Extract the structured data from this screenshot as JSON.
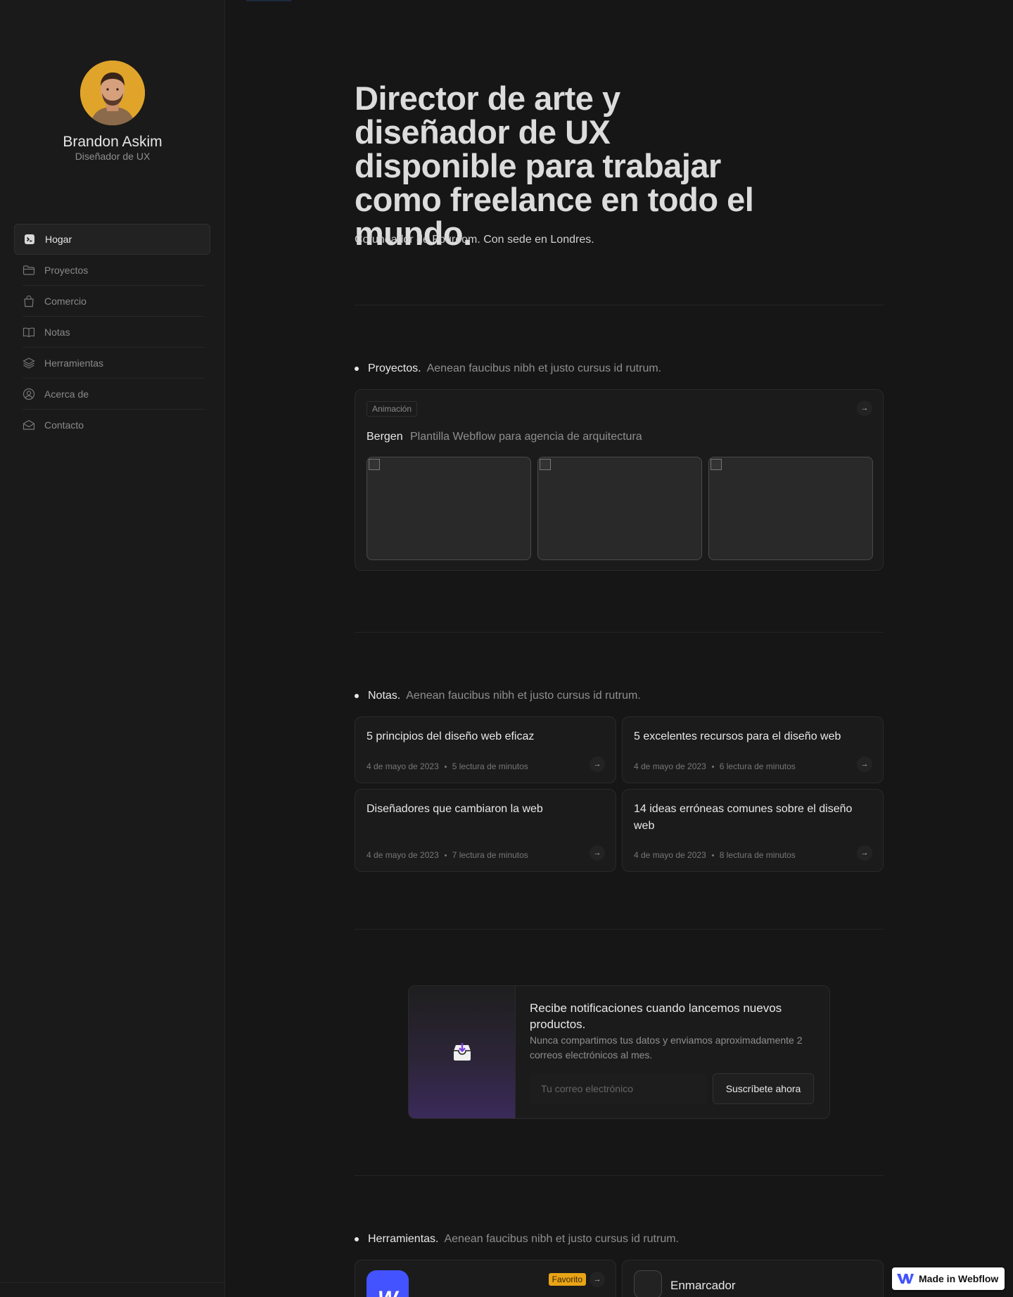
{
  "profile": {
    "name": "Brandon Askim",
    "role": "Diseñador de UX"
  },
  "nav": [
    {
      "label": "Hogar",
      "icon": "terminal-icon",
      "active": true
    },
    {
      "label": "Proyectos",
      "icon": "folder-icon"
    },
    {
      "label": "Comercio",
      "icon": "shopping-bag-icon"
    },
    {
      "label": "Notas",
      "icon": "book-icon"
    },
    {
      "label": "Herramientas",
      "icon": "layers-icon"
    },
    {
      "label": "Acerca de",
      "icon": "user-circle-icon"
    },
    {
      "label": "Contacto",
      "icon": "envelope-icon"
    }
  ],
  "hero": {
    "title": "Director de arte y diseñador de UX disponible para trabajar como freelance en todo el mundo.",
    "subtitle": "Cofundador de Fouroom. Con sede en Londres."
  },
  "projects": {
    "title": "Proyectos.",
    "desc": "Aenean faucibus nibh et justo cursus id rutrum.",
    "card": {
      "tag": "Animación",
      "title": "Bergen",
      "desc": "Plantilla Webflow para agencia de arquitectura",
      "arrow": "→"
    }
  },
  "notes": {
    "title": "Notas.",
    "desc": "Aenean faucibus nibh et justo cursus id rutrum.",
    "items": [
      {
        "title": "5 principios del diseño web eficaz",
        "date": "4 de mayo de 2023",
        "read": "5 lectura de minutos"
      },
      {
        "title": "5 excelentes recursos para el diseño web",
        "date": "4 de mayo de 2023",
        "read": "6 lectura de minutos"
      },
      {
        "title": "Diseñadores que cambiaron la web",
        "date": "4 de mayo de 2023",
        "read": "7 lectura de minutos"
      },
      {
        "title": "14 ideas erróneas comunes sobre el diseño web",
        "date": "4 de mayo de 2023",
        "read": "8 lectura de minutos"
      }
    ]
  },
  "newsletter": {
    "title": "Recibe notificaciones cuando lancemos nuevos productos.",
    "desc": "Nunca compartimos tus datos y enviamos aproximadamente 2 correos electrónicos al mes.",
    "placeholder": "Tu correo electrónico",
    "button": "Suscríbete ahora"
  },
  "tools": {
    "title": "Herramientas.",
    "desc": "Aenean faucibus nibh et justo cursus id rutrum.",
    "items": [
      {
        "logo_letter": "W",
        "badge": "Favorito"
      },
      {
        "name": "Enmarcador"
      }
    ]
  },
  "made_in_webflow": "Made in Webflow",
  "colors": {
    "background": "#161616",
    "sidebar": "#1a1a1a",
    "accent_badge": "#e8a317",
    "webflow_blue": "#4353ff",
    "avatar_bg": "#e0a42a"
  }
}
